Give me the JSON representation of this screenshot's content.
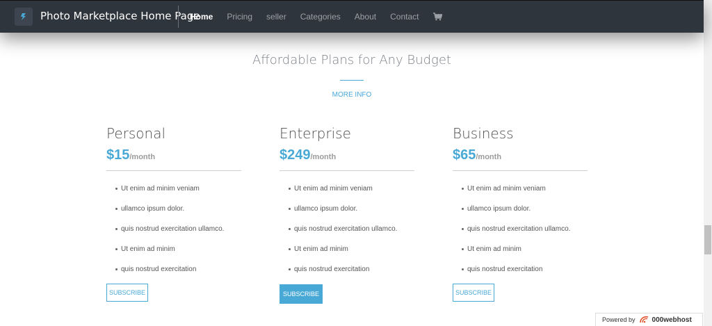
{
  "navbar": {
    "brand": "Photo Marketplace Home Page",
    "links": [
      "Home",
      "Pricing",
      "seller",
      "Categories",
      "About",
      "Contact"
    ],
    "cart_icon": "shopping-cart-icon"
  },
  "section": {
    "title": "Affordable Plans for Any Budget",
    "more_info": "MORE INFO"
  },
  "plans": [
    {
      "name": "Personal",
      "price": "$15",
      "period": "/month",
      "features": [
        "Ut enim ad minim veniam",
        "ullamco ipsum dolor.",
        "quis nostrud exercitation ullamco.",
        "Ut enim ad minim",
        "quis nostrud exercitation"
      ],
      "button": "SUBSCRIBE"
    },
    {
      "name": "Enterprise",
      "price": "$249",
      "period": "/month",
      "features": [
        "Ut enim ad minim veniam",
        "ullamco ipsum dolor.",
        "quis nostrud exercitation ullamco.",
        "Ut enim ad minim",
        "quis nostrud exercitation"
      ],
      "button": "SUBSCRIBE"
    },
    {
      "name": "Business",
      "price": "$65",
      "period": "/month",
      "features": [
        "Ut enim ad minim veniam",
        "ullamco ipsum dolor.",
        "quis nostrud exercitation ullamco.",
        "Ut enim ad minim",
        "quis nostrud exercitation"
      ],
      "button": "SUBSCRIBE"
    }
  ],
  "badge": {
    "powered_by": "Powered by",
    "host": "000webhost"
  },
  "colors": {
    "accent": "#49a9d6",
    "navbar": "#2f353c"
  }
}
